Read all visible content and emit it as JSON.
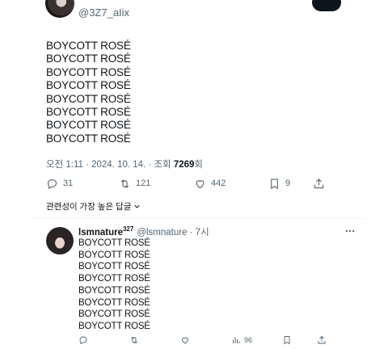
{
  "original_tweet": {
    "handle": "@3Z7_aIix",
    "lines": [
      "BOYCOTT ROSÉ",
      "BOYCOTT ROSÉ",
      "BOYCOTT ROSÉ",
      "BOYCOTT ROSÉ",
      "BOYCOTT ROSÉ",
      "BOYCOTT ROSÉ",
      "BOYCOTT ROSÉ",
      "BOYCOTT ROSÉ"
    ],
    "timestamp": "오전 1:11 · 2024. 10. 14. · 조회 ",
    "views": "7269",
    "views_suffix": "회",
    "counts": {
      "replies": "31",
      "reposts": "121",
      "likes": "442",
      "bookmarks": "9"
    }
  },
  "sort": {
    "label": "관련성이 가장 높은 답글"
  },
  "reply": {
    "name": "lsmnature",
    "name_suffix": "327",
    "handle_time": "@lsmnature · 7시",
    "lines": [
      "BOYCOTT ROSÉ",
      "BOYCOTT ROSÉ",
      "BOYCOTT ROSÉ",
      "BOYCOTT ROSÉ",
      "BOYCOTT ROSÉ",
      "BOYCOTT ROSÉ",
      "BOYCOTT ROSÉ",
      "BOYCOTT ROSÉ"
    ],
    "views": "96"
  },
  "colors": {
    "text": "#0f1419",
    "secondary": "#536471",
    "divider": "#eff3f4"
  }
}
